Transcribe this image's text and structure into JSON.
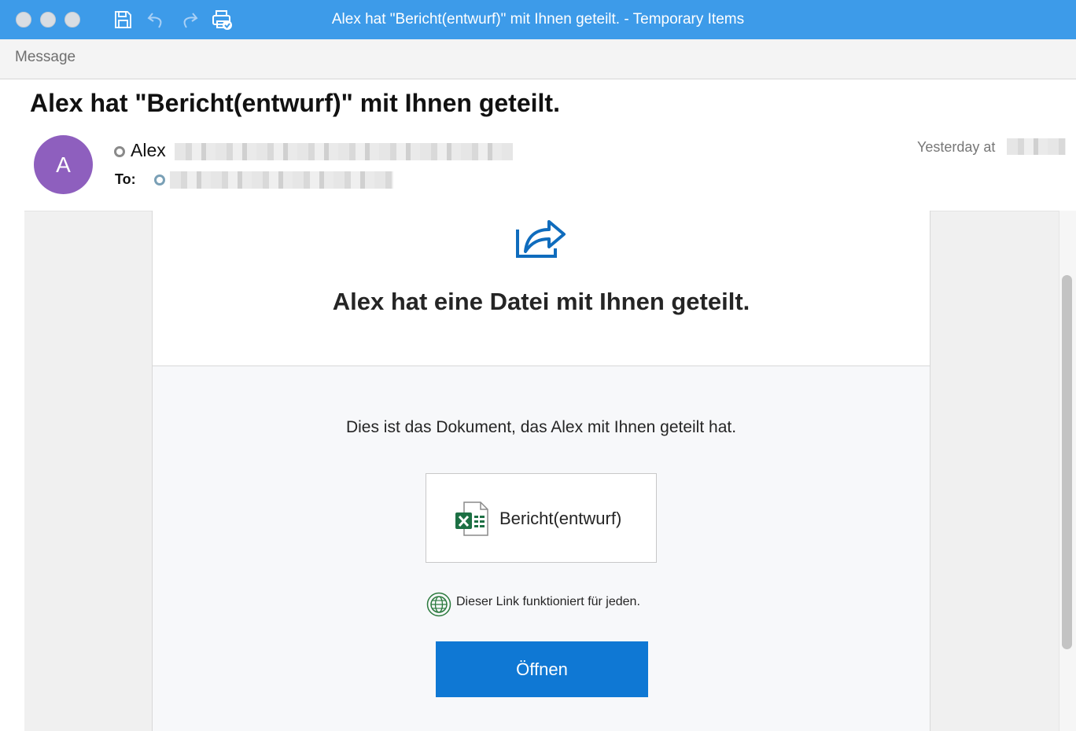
{
  "window": {
    "title": "Alex hat \"Bericht(entwurf)\" mit Ihnen geteilt. - Temporary Items"
  },
  "toolbar": {
    "icons": [
      "save-icon",
      "undo-icon",
      "redo-icon",
      "print-icon"
    ]
  },
  "ribbon": {
    "tab_message": "Message"
  },
  "email": {
    "subject": "Alex hat \"Bericht(entwurf)\" mit Ihnen geteilt.",
    "avatar_initial": "A",
    "sender_name": "Alex",
    "to_label": "To:",
    "date_label": "Yesterday at"
  },
  "body": {
    "heading": "Alex hat eine Datei mit Ihnen geteilt.",
    "description": "Dies ist das Dokument, das Alex mit Ihnen geteilt hat.",
    "file_name": "Bericht(entwurf)",
    "link_note": "Dieser Link funktioniert für jeden.",
    "open_button": "Öffnen"
  },
  "colors": {
    "titlebar": "#3d9be9",
    "avatar": "#8e5fbe",
    "primary_button": "#0f78d4",
    "excel_green": "#1d7044"
  }
}
